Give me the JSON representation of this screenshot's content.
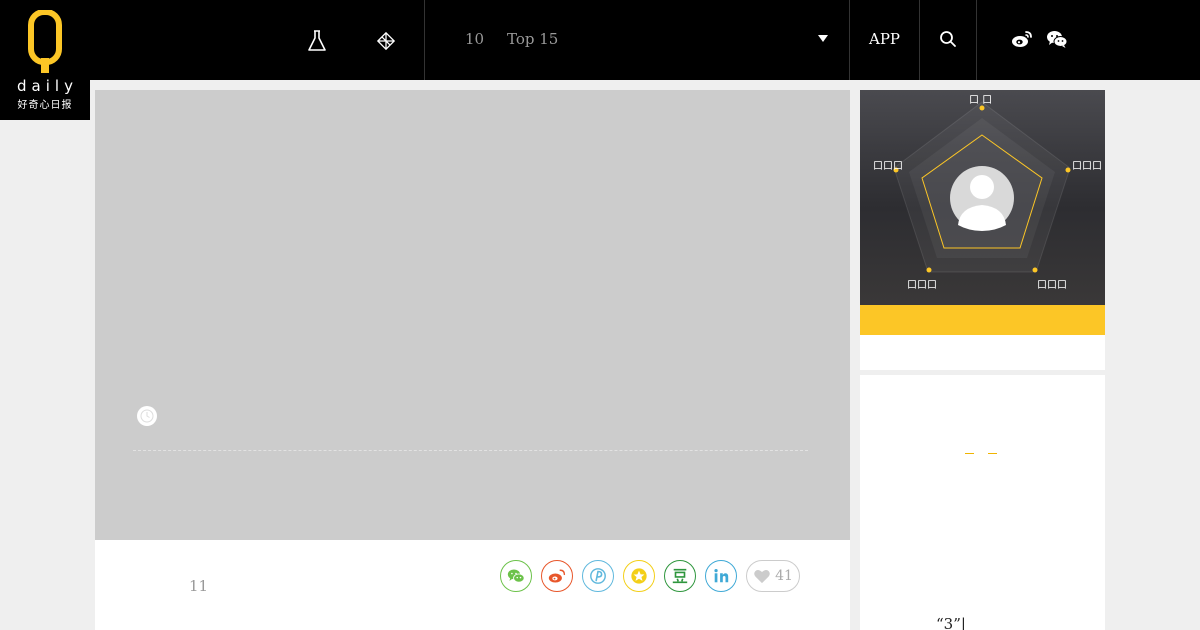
{
  "logo": {
    "letter": "Q",
    "wordmark": "daily",
    "subtitle": "好奇心日报"
  },
  "nav": {
    "items": [
      {
        "icon": "flask-icon"
      },
      {
        "icon": "diamond-icon"
      }
    ],
    "count_label": "10",
    "top_label": "Top 15",
    "app_label": "APP",
    "search_icon": "search-icon",
    "social": [
      "weibo-icon",
      "wechat-icon"
    ]
  },
  "article": {
    "meta_count": "11",
    "share_buttons": [
      {
        "icon": "wechat-icon",
        "color": "#6cc24a"
      },
      {
        "icon": "weibo-icon",
        "color": "#e8562a"
      },
      {
        "icon": "pinterest-p-icon",
        "color": "#5fb8dd"
      },
      {
        "icon": "star-icon",
        "color": "#f3cf18"
      },
      {
        "icon": "douban-icon",
        "color": "#2e963d"
      },
      {
        "icon": "linkedin-icon",
        "color": "#3fa9d6"
      }
    ],
    "likes": "41"
  },
  "sidebar": {
    "radar_labels": {
      "top": "口 口",
      "left": "口口口",
      "right": "口口口",
      "bottom_left": "口口口",
      "bottom_right": "口口口"
    },
    "quote_text": "“3”|"
  },
  "colors": {
    "accent": "#fcc626",
    "header_bg": "#000000",
    "page_bg": "#efefef"
  }
}
